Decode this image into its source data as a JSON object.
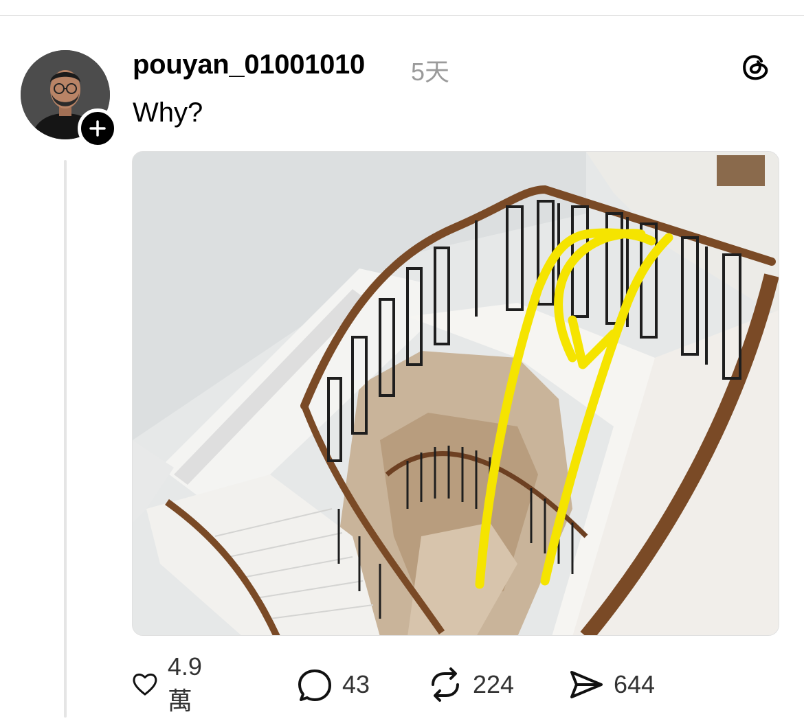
{
  "post": {
    "username": "pouyan_01001010",
    "time": "5天",
    "text": "Why?",
    "avatar_icon": "profile-photo",
    "follow_icon": "plus-icon",
    "app_icon": "threads-logo-icon"
  },
  "actions": {
    "like": {
      "icon": "heart-icon",
      "count": "4.9萬"
    },
    "reply": {
      "icon": "comment-icon",
      "count": "43"
    },
    "repost": {
      "icon": "repost-icon",
      "count": "224"
    },
    "share": {
      "icon": "send-icon",
      "count": "644"
    }
  },
  "colors": {
    "text": "#000000",
    "muted": "#9a9a9a",
    "annotation": "#f5e400",
    "handrail": "#7a4a26"
  }
}
